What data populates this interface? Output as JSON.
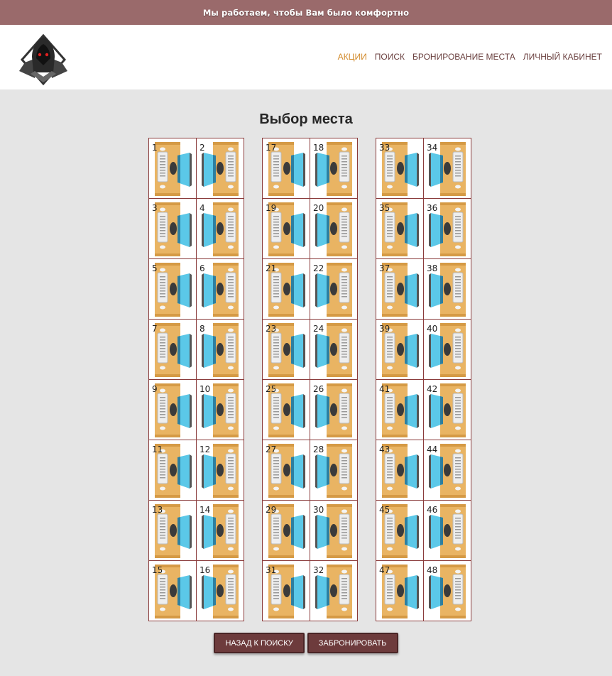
{
  "banner": {
    "text": "Мы работаем, чтобы Вам было комфортно"
  },
  "nav": [
    {
      "label": "АКЦИИ",
      "active": true
    },
    {
      "label": "ПОИСК",
      "active": false
    },
    {
      "label": "БРОНИРОВАНИЕ МЕСТА",
      "active": false
    },
    {
      "label": "ЛИЧНЫЙ КАБИНЕТ",
      "active": false
    }
  ],
  "page": {
    "title": "Выбор места"
  },
  "seat_blocks": [
    {
      "rows": [
        [
          1,
          2
        ],
        [
          3,
          4
        ],
        [
          5,
          6
        ],
        [
          7,
          8
        ],
        [
          9,
          10
        ],
        [
          11,
          12
        ],
        [
          13,
          14
        ],
        [
          15,
          16
        ]
      ]
    },
    {
      "rows": [
        [
          17,
          18
        ],
        [
          19,
          20
        ],
        [
          21,
          22
        ],
        [
          23,
          24
        ],
        [
          25,
          26
        ],
        [
          27,
          28
        ],
        [
          29,
          30
        ],
        [
          31,
          32
        ]
      ]
    },
    {
      "rows": [
        [
          33,
          34
        ],
        [
          35,
          36
        ],
        [
          37,
          38
        ],
        [
          39,
          40
        ],
        [
          41,
          42
        ],
        [
          43,
          44
        ],
        [
          45,
          46
        ],
        [
          47,
          48
        ]
      ]
    }
  ],
  "buttons": {
    "back": "НАЗАД К ПОИСКУ",
    "book": "ЗАБРОНИРОВАТЬ"
  },
  "colors": {
    "banner": "#9a6a6b",
    "nav_active": "#d28a2a",
    "nav": "#6b4140",
    "desk": "#e9b463",
    "monitor": "#5bc8e8",
    "button": "#6d3b3c"
  }
}
